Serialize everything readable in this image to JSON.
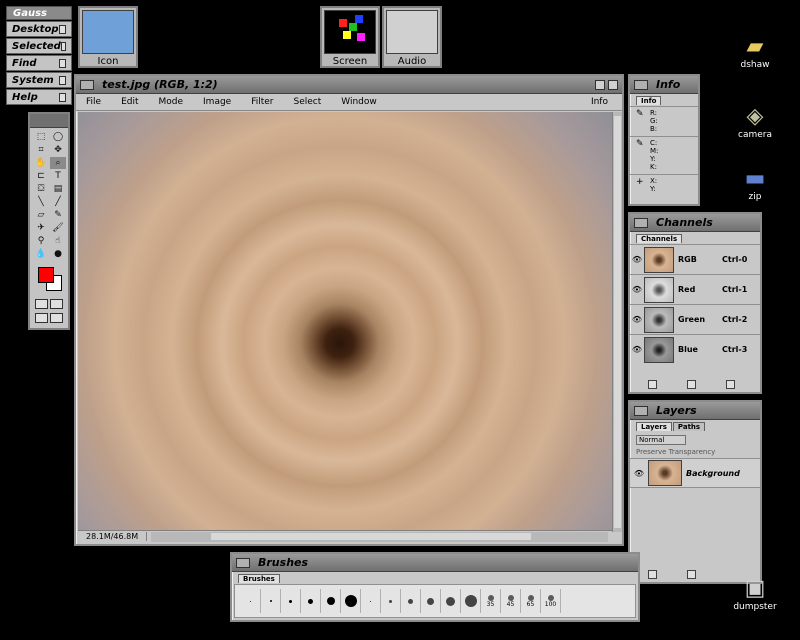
{
  "toolchest": {
    "title": "Gauss",
    "items": [
      "Desktop",
      "Selected",
      "Find",
      "System",
      "Help"
    ]
  },
  "minimized": {
    "icon_catalog": "Icon Catalog",
    "screen_saver": "Screen Saver",
    "audio_panel": "Audio Panel"
  },
  "document": {
    "title": "test.jpg (RGB, 1:2)",
    "menus": [
      "File",
      "Edit",
      "Mode",
      "Image",
      "Filter",
      "Select",
      "Window"
    ],
    "info_menu": "Info",
    "status": "28.1M/46.8M"
  },
  "info_panel": {
    "title": "Info",
    "tab": "Info",
    "rgb_labels": "R:\nG:\nB:",
    "cmyk_labels": "C:\nM:\nY:\nK:",
    "xy_labels": "X:\nY:"
  },
  "channels_panel": {
    "title": "Channels",
    "tab": "Channels",
    "channels": [
      {
        "name": "RGB",
        "key": "Ctrl-0"
      },
      {
        "name": "Red",
        "key": "Ctrl-1"
      },
      {
        "name": "Green",
        "key": "Ctrl-2"
      },
      {
        "name": "Blue",
        "key": "Ctrl-3"
      }
    ]
  },
  "layers_panel": {
    "title": "Layers",
    "tabs": [
      "Layers",
      "Paths"
    ],
    "mode": "Normal",
    "preserve": "Preserve Transparency",
    "layer_name": "Background"
  },
  "brushes_panel": {
    "title": "Brushes",
    "tab": "Brushes",
    "labels": [
      "35",
      "45",
      "65",
      "100"
    ]
  },
  "desktop": {
    "icons": [
      "dshaw",
      "camera",
      "zip",
      "dumpster"
    ]
  },
  "colors": {
    "foreground": "#ff0000",
    "background": "#ffffff"
  }
}
